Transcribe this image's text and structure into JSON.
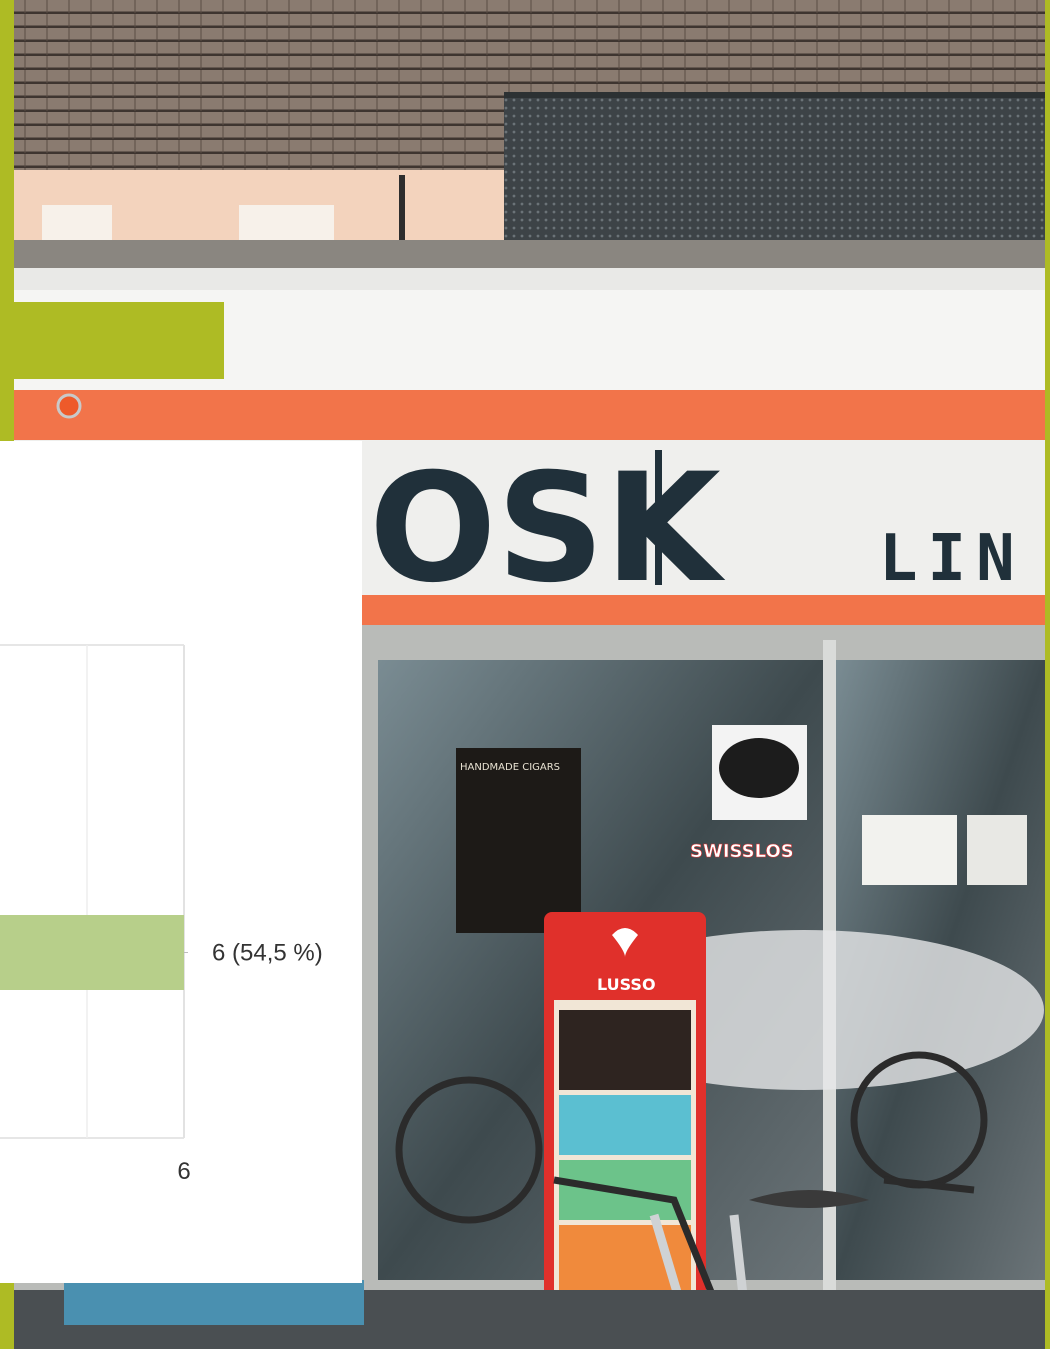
{
  "colors": {
    "frame": "#aebb24",
    "accent_bar": "#aebb24",
    "bar": "#b7cf8a",
    "card": "#ffffff",
    "sign_orange": "#f2744a",
    "sign_text": "#20303a"
  },
  "photo": {
    "sign_text": "OSK",
    "sign_text_right": "LIN",
    "window_labels": [
      "HANDMADE CIGARS",
      "SWISSLOS",
      "LUSSO"
    ]
  },
  "chart_data": {
    "type": "bar",
    "orientation": "horizontal",
    "categories": [
      ""
    ],
    "values": [
      6
    ],
    "data_labels": [
      "6 (54,5 %)"
    ],
    "x_tick_labels": [
      "6"
    ],
    "xlim": [
      0,
      6
    ],
    "grid": true,
    "title": "",
    "xlabel": "",
    "ylabel": ""
  }
}
